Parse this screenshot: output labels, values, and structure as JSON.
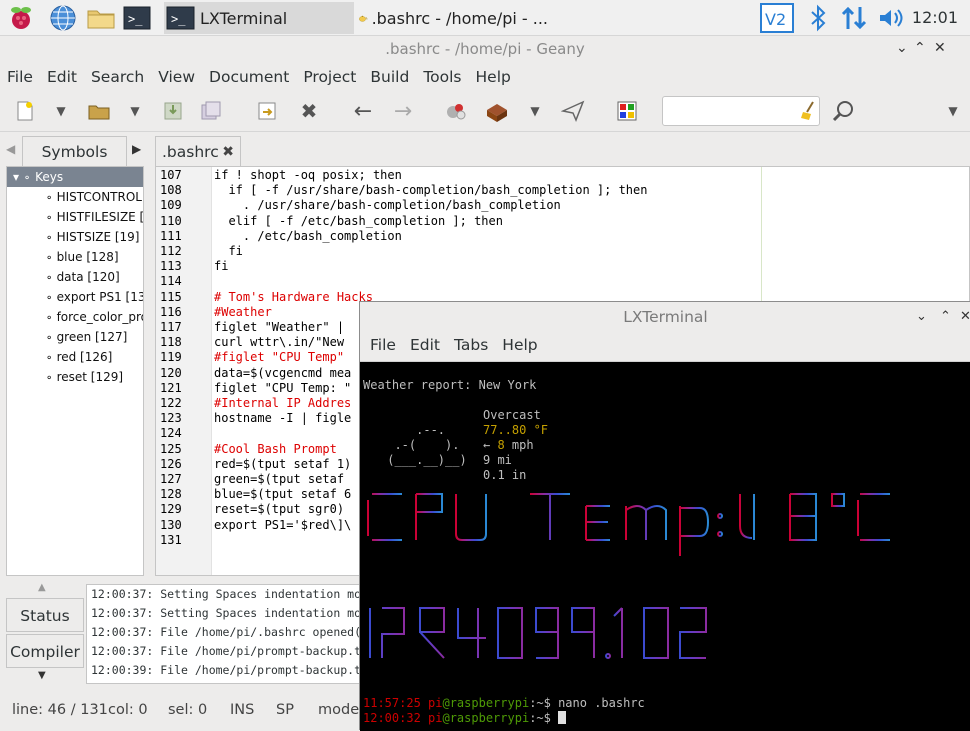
{
  "taskbar": {
    "tasks": [
      {
        "label": "LXTerminal"
      },
      {
        "label": ".bashrc - /home/pi - ..."
      }
    ],
    "clock": "12:01"
  },
  "geany": {
    "title": ".bashrc - /home/pi - Geany",
    "menu": [
      "File",
      "Edit",
      "Search",
      "View",
      "Document",
      "Project",
      "Build",
      "Tools",
      "Help"
    ],
    "sidebar_tab": "Symbols",
    "symbols": {
      "root": "Keys",
      "items": [
        "HISTCONTROL",
        "HISTFILESIZE [",
        "HISTSIZE [19]",
        "blue [128]",
        "data [120]",
        "export PS1 [13",
        "force_color_pro",
        "green [127]",
        "red [126]",
        "reset [129]"
      ]
    },
    "editor_tab": ".bashrc",
    "lines": [
      {
        "n": "107",
        "text": "if ! shopt -oq posix; then"
      },
      {
        "n": "108",
        "text": "  if [ -f /usr/share/bash-completion/bash_completion ]; then"
      },
      {
        "n": "109",
        "text": "    . /usr/share/bash-completion/bash_completion"
      },
      {
        "n": "110",
        "text": "  elif [ -f /etc/bash_completion ]; then"
      },
      {
        "n": "111",
        "text": "    . /etc/bash_completion"
      },
      {
        "n": "112",
        "text": "  fi"
      },
      {
        "n": "113",
        "text": "fi"
      },
      {
        "n": "114",
        "text": ""
      },
      {
        "n": "115",
        "text": "# Tom's Hardware Hacks",
        "cls": "cm"
      },
      {
        "n": "116",
        "text": "#Weather",
        "cls": "cm"
      },
      {
        "n": "117",
        "text": "figlet \"Weather\" |"
      },
      {
        "n": "118",
        "text": "curl wttr\\.in/\"New "
      },
      {
        "n": "119",
        "text": "#figlet \"CPU Temp\"",
        "cls": "cm"
      },
      {
        "n": "120",
        "text": "data=$(vcgencmd mea"
      },
      {
        "n": "121",
        "text": "figlet \"CPU Temp: \""
      },
      {
        "n": "122",
        "text": "#Internal IP Addres",
        "cls": "cm"
      },
      {
        "n": "123",
        "text": "hostname -I | figle"
      },
      {
        "n": "124",
        "text": ""
      },
      {
        "n": "125",
        "text": "#Cool Bash Prompt",
        "cls": "cm"
      },
      {
        "n": "126",
        "text": "red=$(tput setaf 1)"
      },
      {
        "n": "127",
        "text": "green=$(tput setaf "
      },
      {
        "n": "128",
        "text": "blue=$(tput setaf 6"
      },
      {
        "n": "129",
        "text": "reset=$(tput sgr0)"
      },
      {
        "n": "130",
        "text": "export PS1='$red\\]\\"
      },
      {
        "n": "131",
        "text": ""
      }
    ],
    "bottom_tabs": [
      "Status",
      "Compiler"
    ],
    "log": [
      "12:00:37: Setting Spaces indentation mode",
      "12:00:37: Setting Spaces indentation mode",
      "12:00:37: File /home/pi/.bashrc opened(1",
      "12:00:37: File /home/pi/prompt-backup.txt",
      "12:00:39: File /home/pi/prompt-backup.txt"
    ],
    "statusbar": {
      "line": "line: 46 / 131",
      "col": "col: 0",
      "sel": "sel: 0",
      "ins": "INS",
      "sp": "SP",
      "mode": "mode"
    }
  },
  "lxterminal": {
    "title": "LXTerminal",
    "menu": [
      "File",
      "Edit",
      "Tabs",
      "Help"
    ],
    "weather_report": "Weather report: New York",
    "weather": {
      "condition": "Overcast",
      "temp": "77..80 °F",
      "wind_arrow": "←",
      "wind_value": "8",
      "wind_unit": " mph",
      "visibility": "9 mi",
      "precip": "0.1 in"
    },
    "cloud_art": [
      "     .--.    ",
      "  .-(    ).  ",
      " (___.__)__) "
    ],
    "prompts": [
      {
        "time": "11:57:25",
        "user": "pi",
        "host": "@raspberrypi",
        "rest": ":~$ nano .bashrc"
      },
      {
        "time": "12:00:32",
        "user": "pi",
        "host": "@raspberrypi",
        "rest": ":~$ "
      }
    ],
    "colors": {
      "prompt_red": "#cc0000",
      "prompt_green": "#4e9a06",
      "temp_yellow": "#c4a000"
    }
  }
}
